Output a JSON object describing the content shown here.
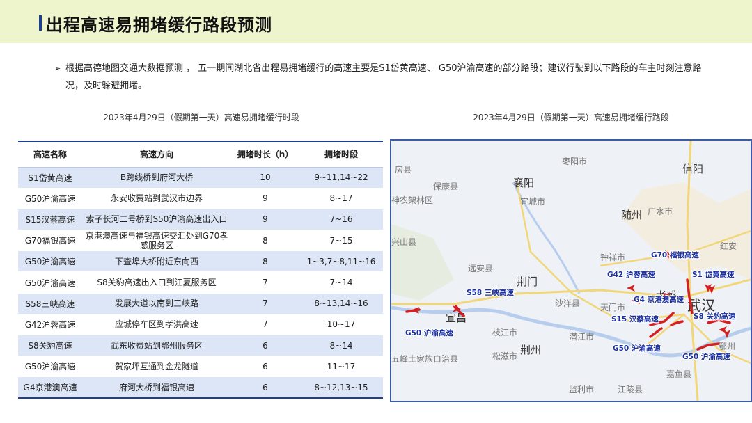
{
  "page_title": "出程高速易拥堵缓行路段预测",
  "intro": {
    "bullet": "➢",
    "text": "根据高德地图交通大数据预测 ， 五一期间湖北省出程易拥堵缓行的高速主要是S1岱黄高速、 G50沪渝高速的部分路段；建议行驶到以下路段的车主时刻注意路况，及时躲避拥堵。"
  },
  "table_caption": "2023年4月29日（假期第一天）高速易拥堵缓行时段",
  "map_caption": "2023年4月29日（假期第一天）高速易拥堵缓行路段",
  "chart_data": {
    "type": "table",
    "columns": [
      "高速名称",
      "高速方向",
      "拥堵时长（h）",
      "拥堵时段"
    ],
    "rows": [
      [
        "S1岱黄高速",
        "B跨线桥到府河大桥",
        "10",
        "9~11,14~22"
      ],
      [
        "G50沪渝高速",
        "永安收费站到武汉市边界",
        "9",
        "8~17"
      ],
      [
        "S15汉蔡高速",
        "索子长河二号桥到S50沪渝高速出入口",
        "9",
        "7~16"
      ],
      [
        "G70福银高速",
        "京港澳高速与福银高速交汇处到G70孝感服务区",
        "8",
        "7~15"
      ],
      [
        "G50沪渝高速",
        "下查埠大桥附近东向西",
        "8",
        "1~3,7~8,11~16"
      ],
      [
        "G50沪渝高速",
        "S8关豹高速出入口到江夏服务区",
        "7",
        "7~14"
      ],
      [
        "S58三峡高速",
        "发展大道以南到三峡路",
        "7",
        "8~13,14~16"
      ],
      [
        "G42沪蓉高速",
        "应城停车区到孝洪高速",
        "7",
        "10~17"
      ],
      [
        "S8关豹高速",
        "武东收费站到鄂州服务区",
        "6",
        "8~14"
      ],
      [
        "G50沪渝高速",
        "贺家坪互通到金龙隧道",
        "6",
        "11~17"
      ],
      [
        "G4京港澳高速",
        "府河大桥到福银高速",
        "6",
        "8~12,13~15"
      ]
    ]
  },
  "map": {
    "place_labels": [
      "枣阳市",
      "信阳",
      "保康县",
      "襄阳",
      "宜城市",
      "随州",
      "广水市",
      "兴山县",
      "钟祥市",
      "红安",
      "远安县",
      "荆门",
      "沙洋县",
      "天门市",
      "孝感",
      "武汉",
      "宜昌",
      "枝江市",
      "荆州",
      "潜江市",
      "五峰土家族自治县",
      "松滋市",
      "嘉鱼县",
      "监利市",
      "江陵县",
      "房县",
      "神农架林区",
      "鄂州"
    ],
    "route_labels": [
      "G70 福银高速",
      "G42 沪蓉高速",
      "S1 岱黄高速",
      "G4 京港澳高速",
      "S58 三峡高速",
      "S15 汉蔡高速",
      "S8 关豹高速",
      "G50 沪渝高速",
      "G50 沪渝高速",
      "G50 沪渝高速"
    ],
    "colors": {
      "congestion": "#d42020",
      "route_label": "#1a2fa0",
      "water": "#b6cdee",
      "road": "#f2d77a",
      "frame": "#3c5aa6"
    }
  }
}
